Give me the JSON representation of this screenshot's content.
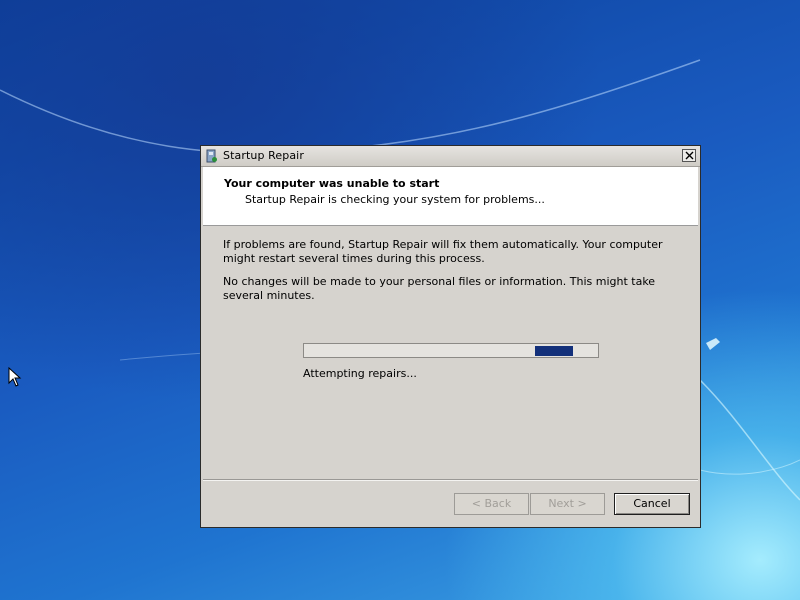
{
  "window": {
    "title": "Startup Repair",
    "close_icon": "close-icon",
    "app_icon": "startup-repair-icon"
  },
  "header": {
    "title": "Your computer was unable to start",
    "subtitle": "Startup Repair is checking your system for problems..."
  },
  "body": {
    "paragraph1": "If problems are found, Startup Repair will fix them automatically. Your computer might restart several times during this process.",
    "paragraph2": "No changes will be made to your personal files or information. This might take several minutes."
  },
  "progress": {
    "style": "marquee",
    "status": "Attempting repairs..."
  },
  "buttons": {
    "back": "< Back",
    "next": "Next >",
    "cancel": "Cancel"
  },
  "colors": {
    "progress_fill": "#13307a",
    "dialog_bg": "#d6d3ce",
    "desktop_blue": "#1a5bc0"
  }
}
